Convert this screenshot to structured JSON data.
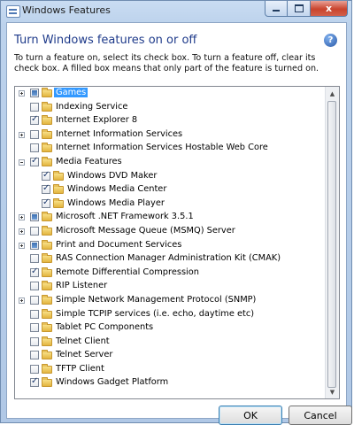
{
  "window": {
    "title": "Windows Features"
  },
  "header": {
    "heading": "Turn Windows features on or off",
    "description": "To turn a feature on, select its check box. To turn a feature off, clear its check box. A filled box means that only part of the feature is turned on."
  },
  "features": [
    {
      "label": "Games",
      "level": 0,
      "expander": "plus",
      "state": "partial",
      "selected": true
    },
    {
      "label": "Indexing Service",
      "level": 0,
      "expander": "none",
      "state": "unchecked"
    },
    {
      "label": "Internet Explorer 8",
      "level": 0,
      "expander": "none",
      "state": "checked"
    },
    {
      "label": "Internet Information Services",
      "level": 0,
      "expander": "plus",
      "state": "unchecked"
    },
    {
      "label": "Internet Information Services Hostable Web Core",
      "level": 0,
      "expander": "none",
      "state": "unchecked"
    },
    {
      "label": "Media Features",
      "level": 0,
      "expander": "minus",
      "state": "checked"
    },
    {
      "label": "Windows DVD Maker",
      "level": 1,
      "expander": "none",
      "state": "checked"
    },
    {
      "label": "Windows Media Center",
      "level": 1,
      "expander": "none",
      "state": "checked"
    },
    {
      "label": "Windows Media Player",
      "level": 1,
      "expander": "none",
      "state": "checked"
    },
    {
      "label": "Microsoft .NET Framework 3.5.1",
      "level": 0,
      "expander": "plus",
      "state": "partial"
    },
    {
      "label": "Microsoft Message Queue (MSMQ) Server",
      "level": 0,
      "expander": "plus",
      "state": "unchecked"
    },
    {
      "label": "Print and Document Services",
      "level": 0,
      "expander": "plus",
      "state": "partial"
    },
    {
      "label": "RAS Connection Manager Administration Kit (CMAK)",
      "level": 0,
      "expander": "none",
      "state": "unchecked"
    },
    {
      "label": "Remote Differential Compression",
      "level": 0,
      "expander": "none",
      "state": "checked"
    },
    {
      "label": "RIP Listener",
      "level": 0,
      "expander": "none",
      "state": "unchecked"
    },
    {
      "label": "Simple Network Management Protocol (SNMP)",
      "level": 0,
      "expander": "plus",
      "state": "unchecked"
    },
    {
      "label": "Simple TCPIP services (i.e. echo, daytime etc)",
      "level": 0,
      "expander": "none",
      "state": "unchecked"
    },
    {
      "label": "Tablet PC Components",
      "level": 0,
      "expander": "none",
      "state": "unchecked"
    },
    {
      "label": "Telnet Client",
      "level": 0,
      "expander": "none",
      "state": "unchecked"
    },
    {
      "label": "Telnet Server",
      "level": 0,
      "expander": "none",
      "state": "unchecked"
    },
    {
      "label": "TFTP Client",
      "level": 0,
      "expander": "none",
      "state": "unchecked"
    },
    {
      "label": "Windows Gadget Platform",
      "level": 0,
      "expander": "none",
      "state": "checked"
    }
  ],
  "buttons": {
    "ok": "OK",
    "cancel": "Cancel"
  },
  "icons": {
    "help": "?",
    "close": "x"
  }
}
